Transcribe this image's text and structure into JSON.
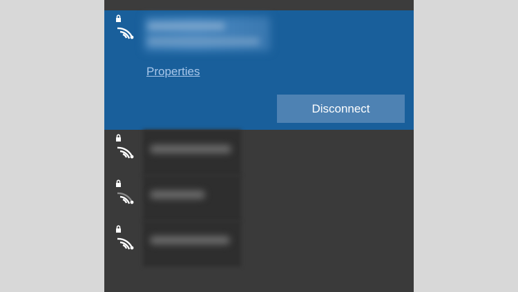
{
  "connected_network": {
    "properties_label": "Properties",
    "disconnect_label": "Disconnect",
    "signal_icon": "wifi-secured-icon"
  },
  "other_networks": [
    {
      "signal_icon": "wifi-secured-icon"
    },
    {
      "signal_icon": "wifi-secured-weak-icon"
    },
    {
      "signal_icon": "wifi-secured-icon"
    }
  ],
  "colors": {
    "accent": "#195f9b",
    "button": "#4e82b3",
    "link": "#a9c7ea",
    "background": "#3a3a3a"
  }
}
